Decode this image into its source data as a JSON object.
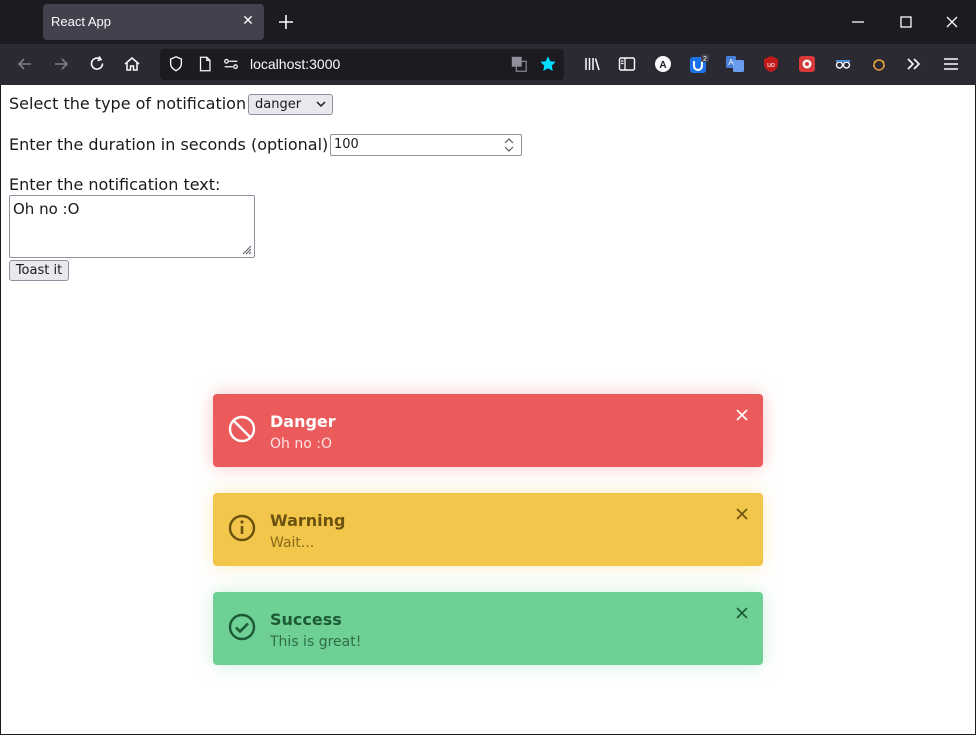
{
  "browser": {
    "tab_title": "React App",
    "url": "localhost:3000"
  },
  "form": {
    "type_label": "Select the type of notification:",
    "type_value": "danger",
    "duration_label": "Enter the duration in seconds (optional):",
    "duration_value": "100",
    "text_label": "Enter the notification text:",
    "text_value": "Oh no :O",
    "submit_label": "Toast it"
  },
  "toasts": [
    {
      "type": "danger",
      "title": "Danger",
      "message": "Oh no :O",
      "icon": "ban-icon",
      "color": "#ec5b5b"
    },
    {
      "type": "warning",
      "title": "Warning",
      "message": "Wait...",
      "icon": "info-icon",
      "color": "#f2c64a"
    },
    {
      "type": "success",
      "title": "Success",
      "message": "This is great!",
      "icon": "check-circle-icon",
      "color": "#6fd096"
    }
  ]
}
